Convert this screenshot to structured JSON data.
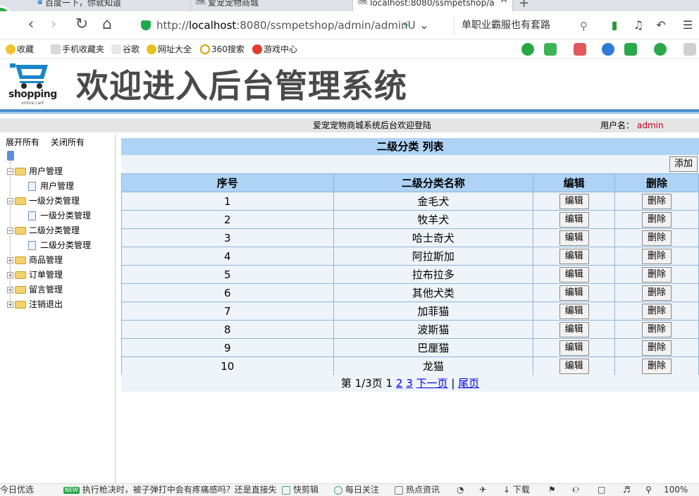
{
  "browser": {
    "tabs": [
      {
        "label": "百度一下，你就知道"
      },
      {
        "label": "爱宠宠物商城"
      },
      {
        "label": "localhost:8080/ssmpetshop/a"
      }
    ],
    "new_tab": "+",
    "url_prefix": "http://",
    "url_host": "localhost",
    "url_rest": ":8080/ssmpetshop/admin/adminU",
    "search_text": "单职业霸服也有套路",
    "bookmarks": [
      "收藏",
      "手机收藏夹",
      "谷歌",
      "网址大全",
      "360搜索",
      "游戏中心"
    ]
  },
  "site": {
    "logo_text": "shopping",
    "logo_sub": "online cart",
    "title": "欢迎进入后台管理系统",
    "welcome_msg": "爱宠宠物商城系统后台欢迎登陆",
    "user_label": "用户名：",
    "user_name": "admin"
  },
  "sidebar": {
    "expand_all": "展开所有",
    "collapse_all": "关闭所有",
    "groups": [
      {
        "label": "用户管理",
        "child": "用户管理"
      },
      {
        "label": "一级分类管理",
        "child": "一级分类管理"
      },
      {
        "label": "二级分类管理",
        "child": "二级分类管理"
      },
      {
        "label": "商品管理"
      },
      {
        "label": "订单管理"
      },
      {
        "label": "留言管理"
      },
      {
        "label": "注销退出"
      }
    ]
  },
  "main": {
    "title": "二级分类 列表",
    "add_label": "添加",
    "headers": [
      "序号",
      "二级分类名称",
      "编辑",
      "删除"
    ],
    "edit_label": "编辑",
    "delete_label": "删除",
    "rows": [
      {
        "no": "1",
        "name": "金毛犬"
      },
      {
        "no": "2",
        "name": "牧羊犬"
      },
      {
        "no": "3",
        "name": "哈士奇犬"
      },
      {
        "no": "4",
        "name": "阿拉斯加"
      },
      {
        "no": "5",
        "name": "拉布拉多"
      },
      {
        "no": "6",
        "name": "其他犬类"
      },
      {
        "no": "7",
        "name": "加菲猫"
      },
      {
        "no": "8",
        "name": "波斯猫"
      },
      {
        "no": "9",
        "name": "巴厘猫"
      },
      {
        "no": "10",
        "name": "龙猫"
      }
    ],
    "pager": {
      "info": "第 1/3页",
      "current": "1",
      "pages": [
        "2",
        "3"
      ],
      "next": "下一页",
      "sep": "|",
      "last": "尾页"
    }
  },
  "statusbar": {
    "today": "今日优选",
    "new_badge": "NEW",
    "news": "执行枪决时，被子弹打中会有疼痛感吗？还是直接失",
    "items": [
      "快剪辑",
      "每日关注",
      "热点资讯",
      "下载"
    ],
    "zoom": "100%"
  },
  "colors": {
    "header_blue": "#aed3f5",
    "row_bg": "#eef4fa",
    "rule_blue": "#4a8ed3",
    "username_red": "#c0001e"
  }
}
